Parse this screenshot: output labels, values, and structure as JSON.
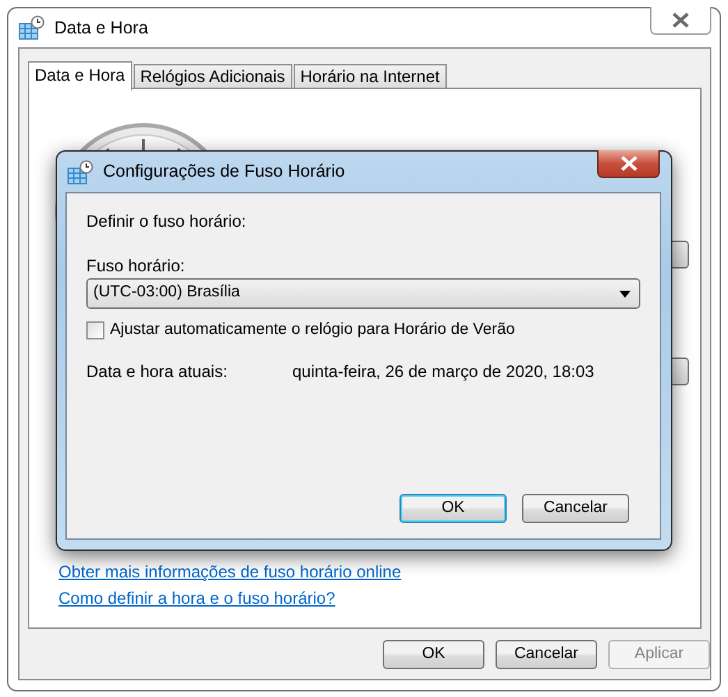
{
  "window": {
    "title": "Data e Hora"
  },
  "tabs": [
    {
      "label": "Data e Hora",
      "selected": true
    },
    {
      "label": "Relógios Adicionais",
      "selected": false
    },
    {
      "label": "Horário na Internet",
      "selected": false
    }
  ],
  "links": [
    "Obter mais informações de fuso horário online",
    "Como definir a hora e o fuso horário?"
  ],
  "buttons": [
    {
      "label": "OK",
      "disabled": false
    },
    {
      "label": "Cancelar",
      "disabled": false
    },
    {
      "label": "Aplicar",
      "disabled": true
    }
  ],
  "dialog": {
    "title": "Configurações de Fuso Horário",
    "heading": "Definir o fuso horário:",
    "timezone_label": "Fuso horário:",
    "timezone": "(UTC-03:00) Brasília",
    "dst_checkbox": {
      "label": "Ajustar automaticamente o relógio para Horário de Verão",
      "checked": false
    },
    "current_label": "Data e hora atuais:",
    "current_value": "quinta-feira, 26 de março de 2020, 18:03",
    "buttons": [
      {
        "label": "OK",
        "default": true
      },
      {
        "label": "Cancelar",
        "default": false
      }
    ]
  }
}
